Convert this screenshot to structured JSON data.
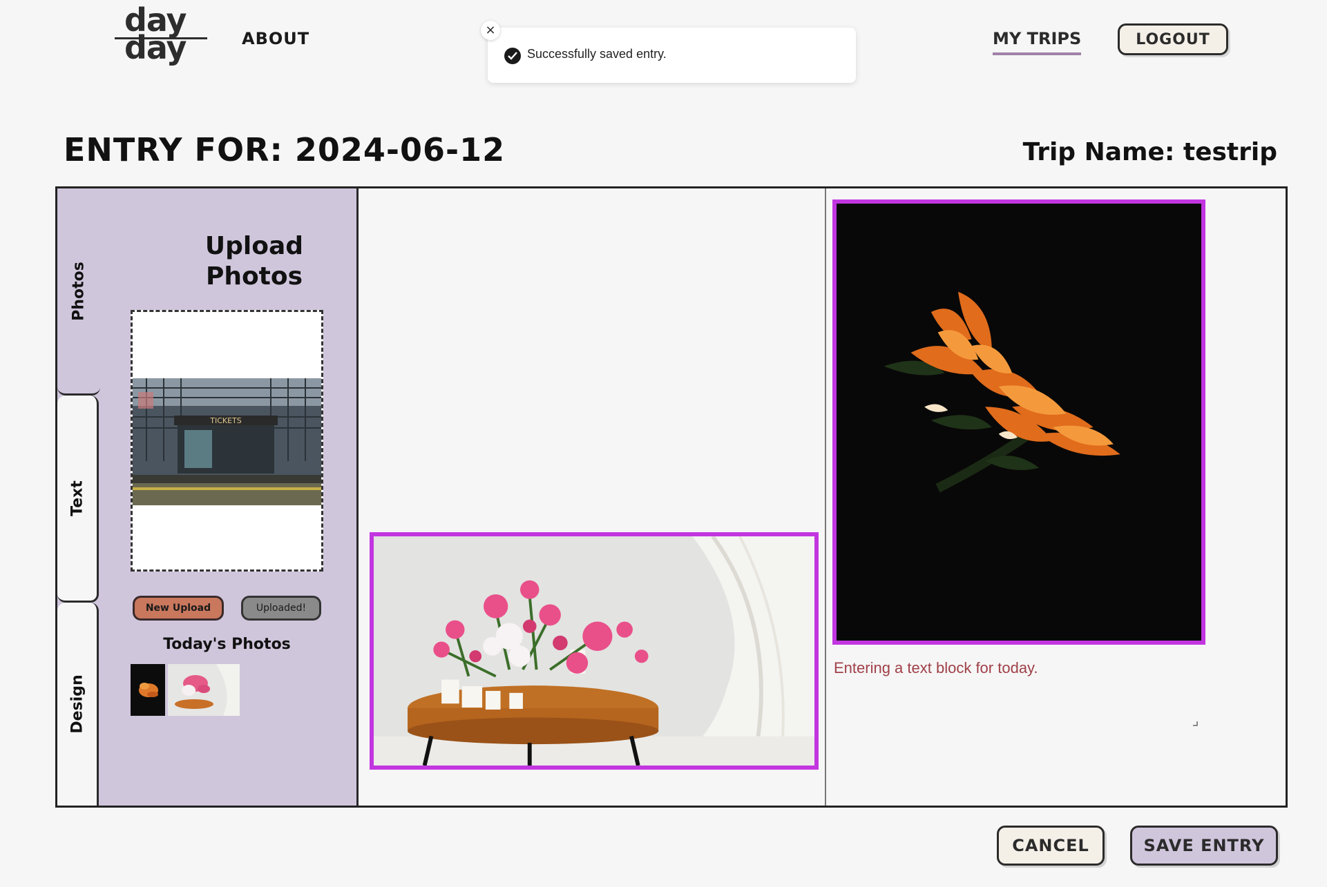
{
  "header": {
    "logo_word_1": "day",
    "logo_word_2": "day",
    "nav_about": "ABOUT",
    "nav_my_trips": "MY TRIPS",
    "logout_label": "LOGOUT"
  },
  "toast": {
    "message": "Successfully saved entry.",
    "close_glyph": "×"
  },
  "entry": {
    "title": "ENTRY FOR: 2024-06-12",
    "trip_name": "Trip Name: testrip"
  },
  "sidebar": {
    "tabs": [
      {
        "label": "Photos",
        "active": true
      },
      {
        "label": "Text",
        "active": false
      },
      {
        "label": "Design",
        "active": false
      }
    ],
    "upload_heading": "Upload Photos",
    "new_upload_label": "New Upload",
    "uploaded_label": "Uploaded!",
    "todays_photos_heading": "Today's Photos"
  },
  "canvas": {
    "text_block": "Entering a text block for today."
  },
  "footer": {
    "cancel_label": "CANCEL",
    "save_label": "SAVE ENTRY"
  },
  "colors": {
    "background": "#f6f6f6",
    "sidebar": "#d0c6dc",
    "selection_border": "#c236e0",
    "new_upload_button": "#c9775d",
    "text_block_color": "#a04048",
    "nav_underline": "#a081a9"
  },
  "icons": {
    "toast_check": "check-circle-icon",
    "toast_close": "close-icon",
    "resize": "resize-handle-icon"
  }
}
